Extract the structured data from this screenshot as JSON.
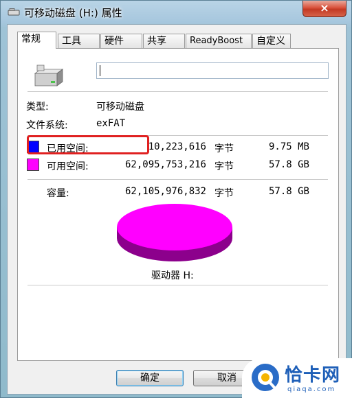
{
  "window": {
    "title": "可移动磁盘 (H:) 属性",
    "close_glyph": "×"
  },
  "tabs": [
    {
      "label": "常规",
      "active": true
    },
    {
      "label": "工具"
    },
    {
      "label": "硬件"
    },
    {
      "label": "共享"
    },
    {
      "label": "ReadyBoost"
    },
    {
      "label": "自定义"
    }
  ],
  "general": {
    "name_value": "",
    "type_label": "类型:",
    "type_value": "可移动磁盘",
    "fs_label": "文件系统:",
    "fs_value": "exFAT",
    "used": {
      "label": "已用空间:",
      "bytes": "10,223,616",
      "unit": "字节",
      "size": "9.75 MB",
      "color": "#0000ff"
    },
    "free": {
      "label": "可用空间:",
      "bytes": "62,095,753,216",
      "unit": "字节",
      "size": "57.8 GB",
      "color": "#ff00ff"
    },
    "capacity": {
      "label": "容量:",
      "bytes": "62,105,976,832",
      "unit": "字节",
      "size": "57.8 GB"
    },
    "drive_label": "驱动器 H:"
  },
  "buttons": {
    "ok": "确定",
    "cancel": "取消"
  },
  "watermark": {
    "name": "恰卡网",
    "url": "qiaqa.com"
  }
}
